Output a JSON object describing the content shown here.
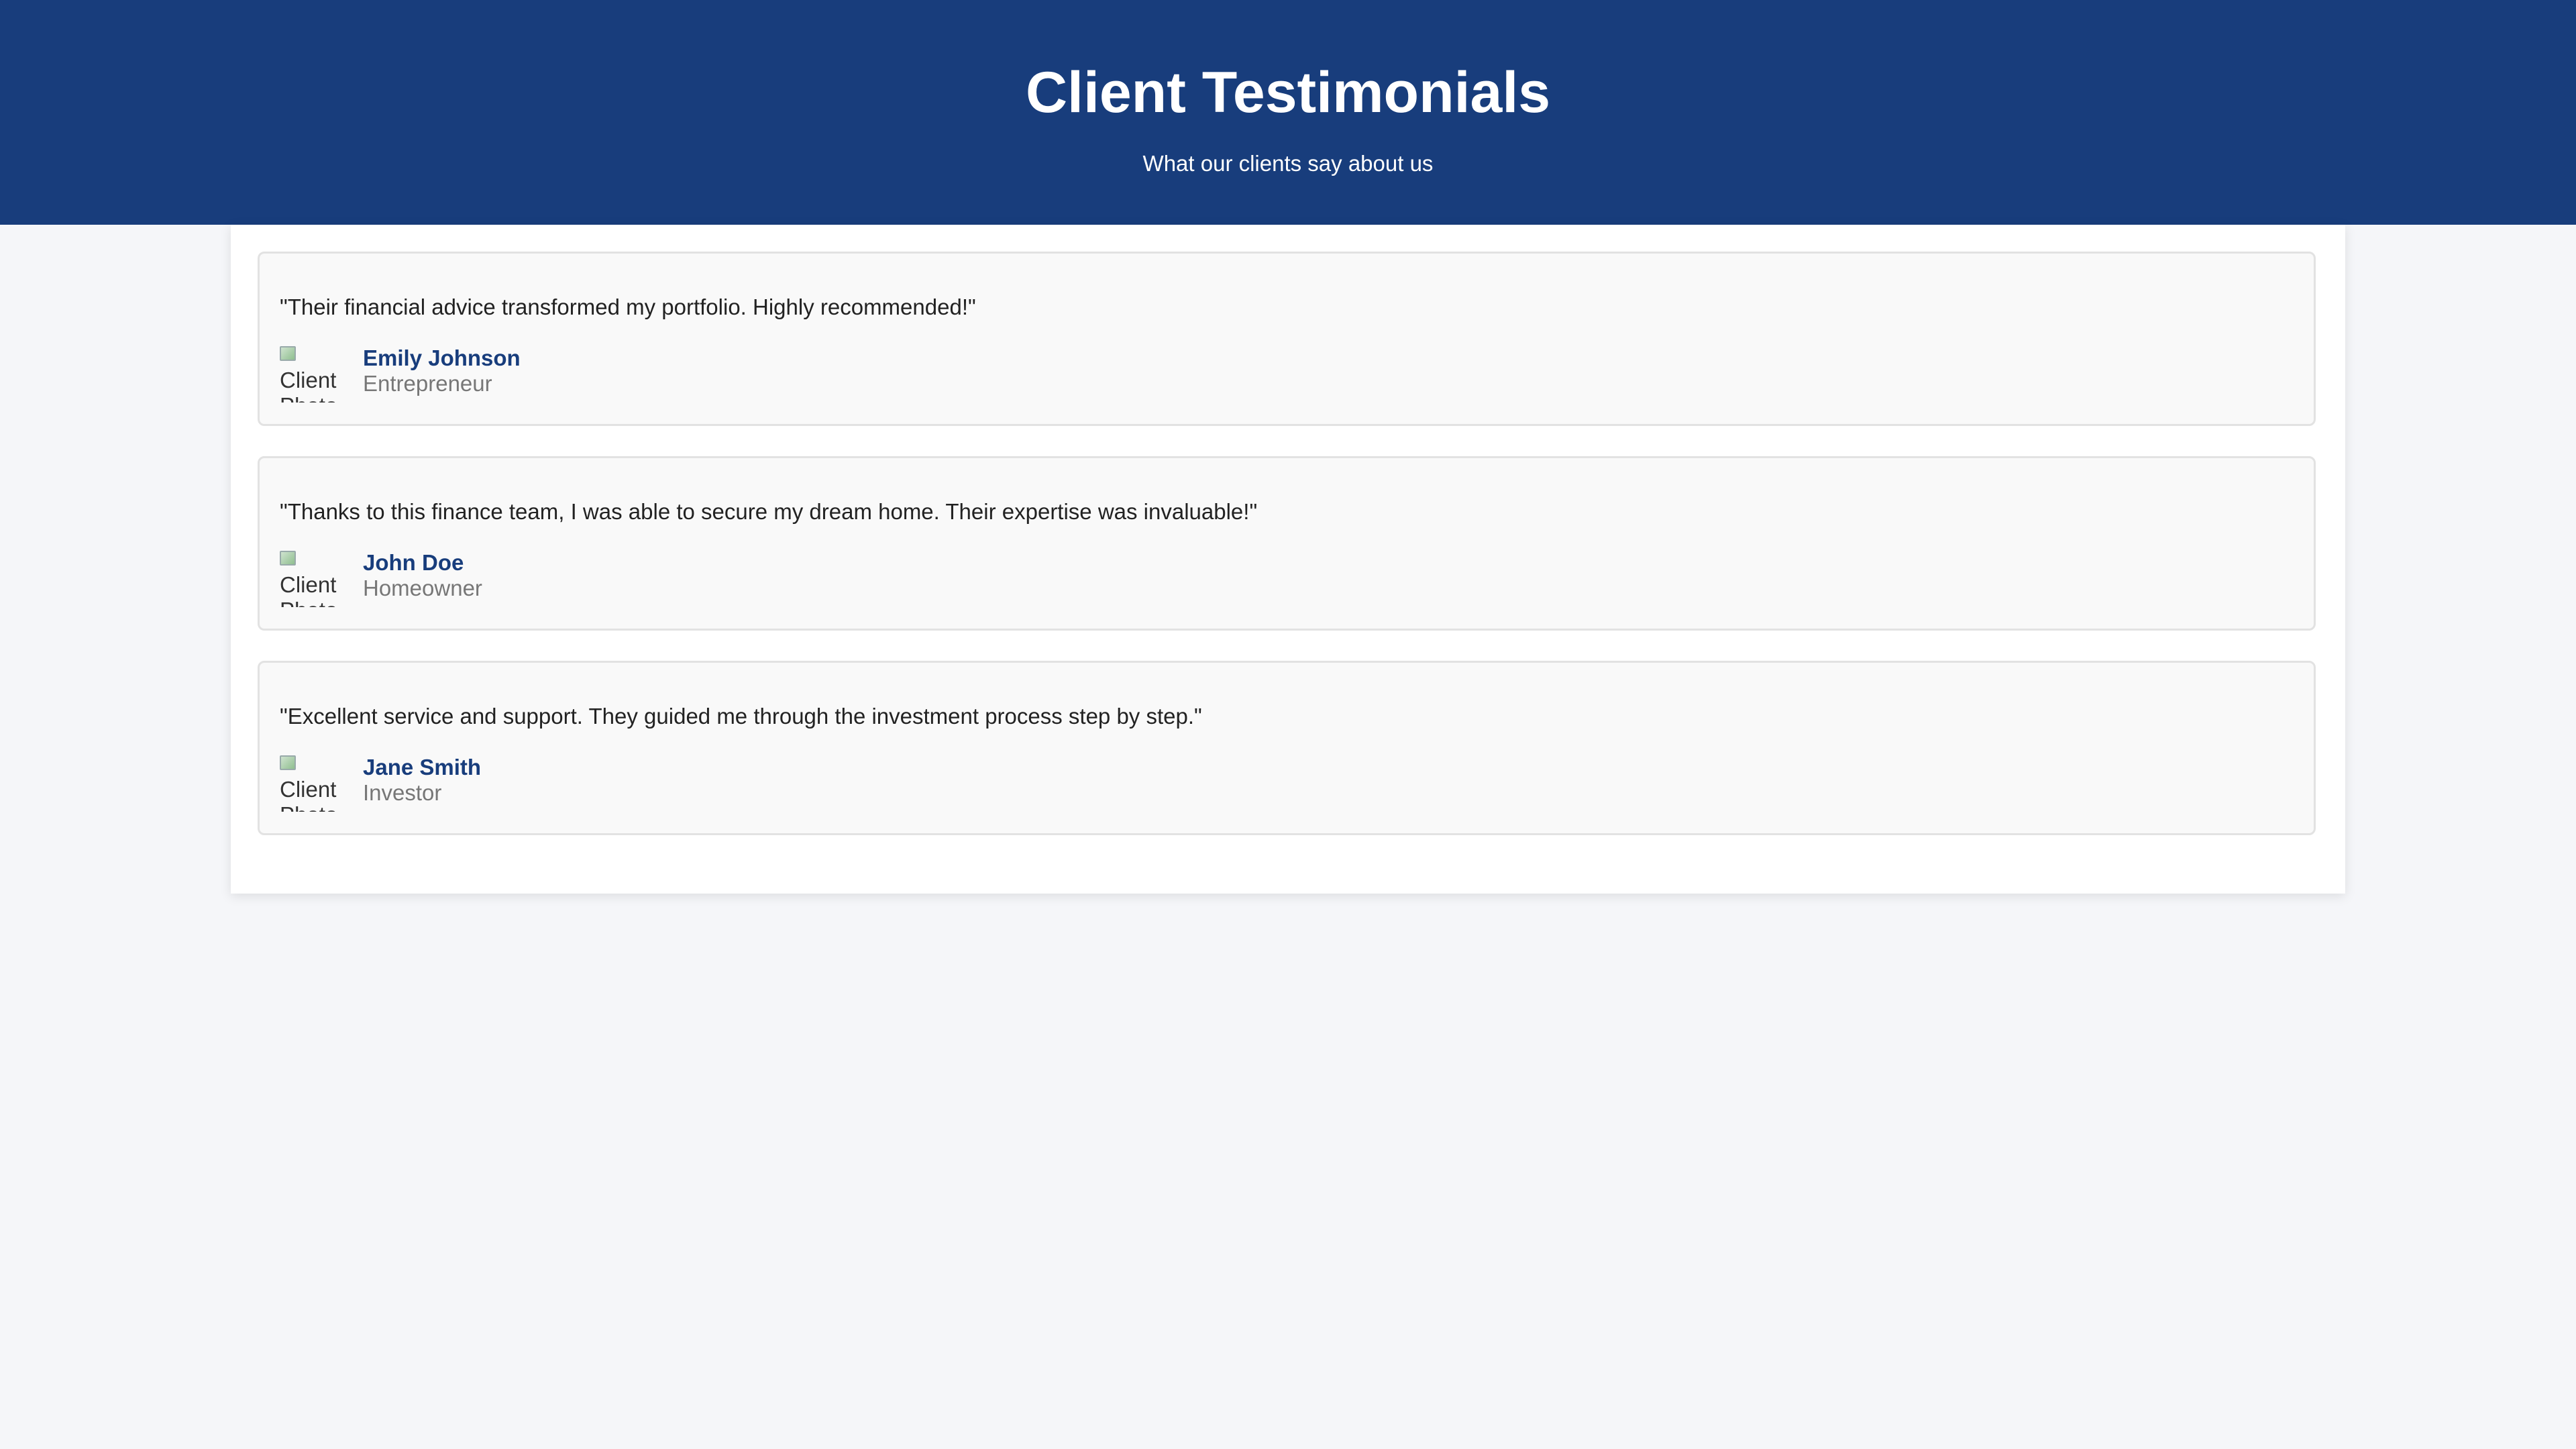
{
  "header": {
    "title": "Client Testimonials",
    "subtitle": "What our clients say about us"
  },
  "colors": {
    "header_bg": "#183d7c",
    "name_color": "#183d7c",
    "page_bg": "#f5f6f9"
  },
  "testimonials": [
    {
      "quote": "\"Their financial advice transformed my portfolio. Highly recommended!\"",
      "avatar_alt": "Client Photo",
      "name": "Emily Johnson",
      "role": "Entrepreneur"
    },
    {
      "quote": "\"Thanks to this finance team, I was able to secure my dream home. Their expertise was invaluable!\"",
      "avatar_alt": "Client Photo",
      "name": "John Doe",
      "role": "Homeowner"
    },
    {
      "quote": "\"Excellent service and support. They guided me through the investment process step by step.\"",
      "avatar_alt": "Client Photo",
      "name": "Jane Smith",
      "role": "Investor"
    }
  ]
}
